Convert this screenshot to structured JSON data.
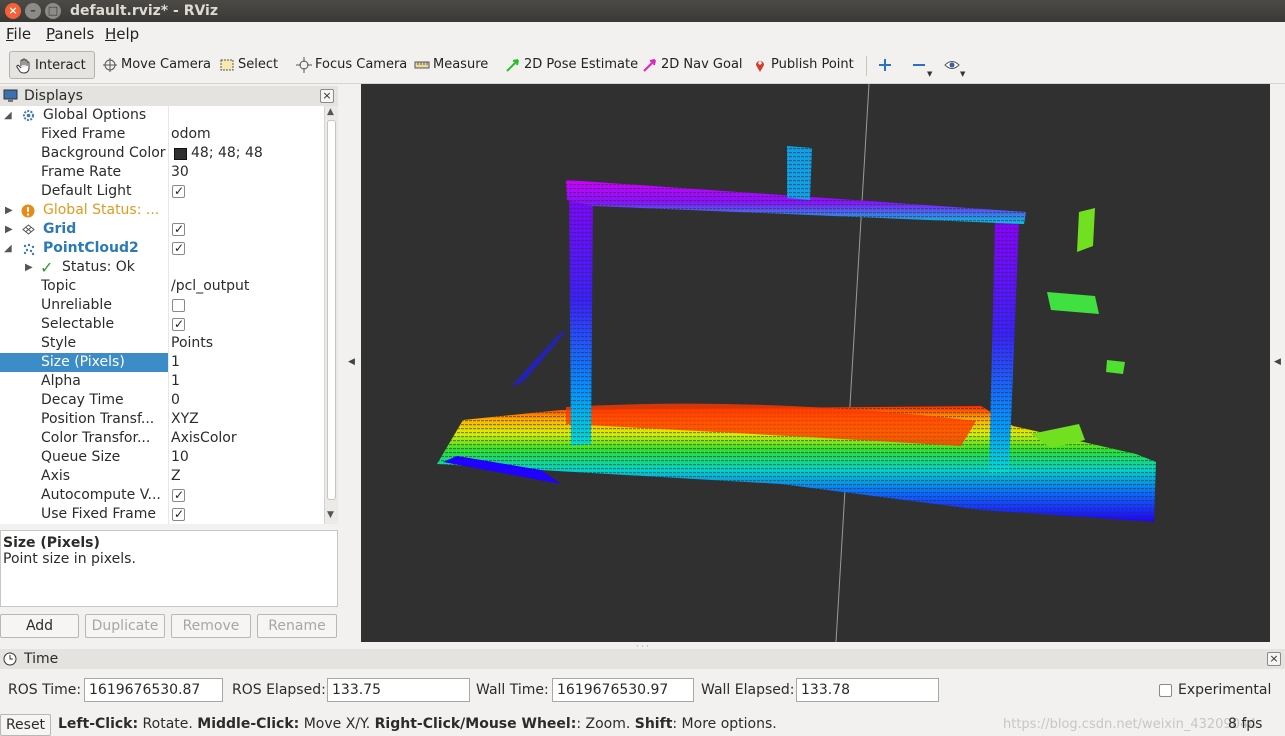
{
  "window": {
    "title": "default.rviz* - RViz"
  },
  "menu": {
    "file": {
      "u": "F",
      "rest": "ile"
    },
    "panels": {
      "u": "P",
      "rest": "anels"
    },
    "help": {
      "u": "H",
      "rest": "elp"
    }
  },
  "toolbar": {
    "interact": "Interact",
    "move_camera": "Move Camera",
    "select": "Select",
    "focus_camera": "Focus Camera",
    "measure": "Measure",
    "pose_estimate": "2D Pose Estimate",
    "nav_goal": "2D Nav Goal",
    "publish_point": "Publish Point"
  },
  "displays": {
    "title": "Displays",
    "rows": [
      {
        "label": "Global Options",
        "value": ""
      },
      {
        "label": "Fixed Frame",
        "value": "odom"
      },
      {
        "label": "Background Color",
        "value": "48; 48; 48"
      },
      {
        "label": "Frame Rate",
        "value": "30"
      },
      {
        "label": "Default Light",
        "value": ""
      },
      {
        "label": "Global Status: ...",
        "value": ""
      },
      {
        "label": "Grid",
        "value": ""
      },
      {
        "label": "PointCloud2",
        "value": ""
      },
      {
        "label": "Status: Ok",
        "value": ""
      },
      {
        "label": "Topic",
        "value": "/pcl_output"
      },
      {
        "label": "Unreliable",
        "value": ""
      },
      {
        "label": "Selectable",
        "value": ""
      },
      {
        "label": "Style",
        "value": "Points"
      },
      {
        "label": "Size (Pixels)",
        "value": "1"
      },
      {
        "label": "Alpha",
        "value": "1"
      },
      {
        "label": "Decay Time",
        "value": "0"
      },
      {
        "label": "Position Transf...",
        "value": "XYZ"
      },
      {
        "label": "Color Transfor...",
        "value": "AxisColor"
      },
      {
        "label": "Queue Size",
        "value": "10"
      },
      {
        "label": "Axis",
        "value": "Z"
      },
      {
        "label": "Autocompute V...",
        "value": ""
      },
      {
        "label": "Use Fixed Frame",
        "value": ""
      }
    ],
    "desc_title": "Size (Pixels)",
    "desc_text": "Point size in pixels.",
    "buttons": {
      "add": "Add",
      "duplicate": "Duplicate",
      "remove": "Remove",
      "rename": "Rename"
    }
  },
  "time": {
    "title": "Time",
    "ros_time_label": "ROS Time:",
    "ros_time": "1619676530.87",
    "ros_elapsed_label": "ROS Elapsed:",
    "ros_elapsed": "133.75",
    "wall_time_label": "Wall Time:",
    "wall_time": "1619676530.97",
    "wall_elapsed_label": "Wall Elapsed:",
    "wall_elapsed": "133.78",
    "experimental": "Experimental"
  },
  "status": {
    "reset": "Reset",
    "k1": "Left-Click:",
    "t1": " Rotate. ",
    "k2": "Middle-Click:",
    "t2": " Move X/Y. ",
    "k3": "Right-Click/Mouse Wheel:",
    "t3": ": Zoom. ",
    "k4": "Shift",
    "t4": ": More options.",
    "fps": "8 fps",
    "watermark": "https://blog.csdn.net/weixin_43209044"
  },
  "colors": {
    "background": "#303030",
    "selection": "#3c8cc8",
    "status_warn": "#e09a1e",
    "link_blue": "#2a7ab8"
  }
}
